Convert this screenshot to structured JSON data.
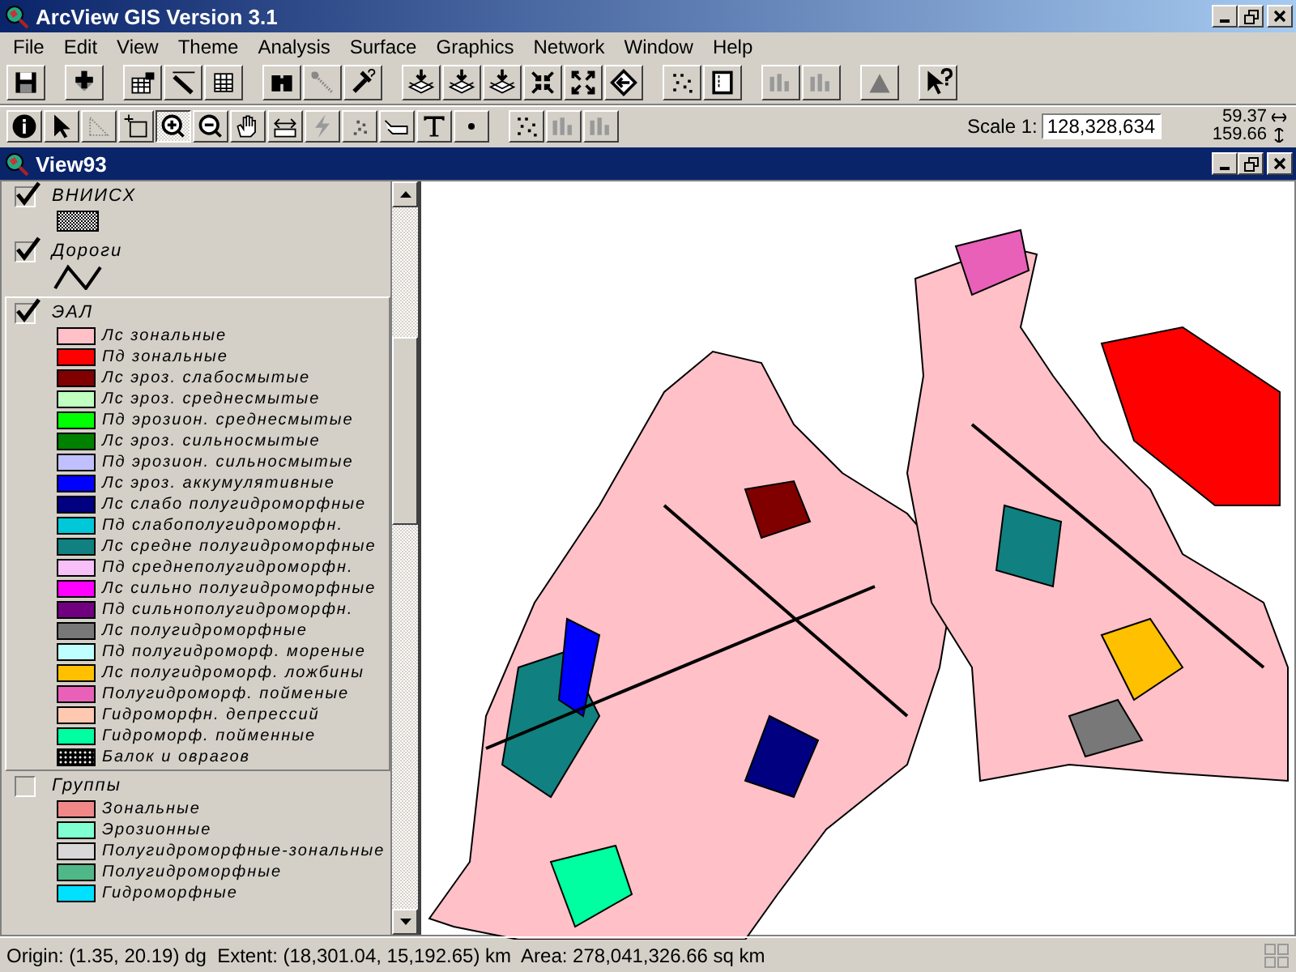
{
  "window": {
    "title": "ArcView GIS Version 3.1"
  },
  "menu": [
    "File",
    "Edit",
    "View",
    "Theme",
    "Analysis",
    "Surface",
    "Graphics",
    "Network",
    "Window",
    "Help"
  ],
  "tool_bar": {
    "tools": [
      {
        "selected": false
      },
      {
        "selected": false
      },
      {
        "selected": false
      },
      {
        "selected": false
      },
      {
        "selected": true
      },
      {
        "selected": false
      },
      {
        "selected": false
      },
      {
        "selected": false
      },
      {
        "selected": false
      },
      {
        "selected": false
      },
      {
        "selected": false
      },
      {
        "selected": false
      },
      {
        "selected": false
      }
    ],
    "scale_label": "Scale 1:",
    "scale_value": "128,328,634",
    "x_reading": "59.37",
    "y_reading": "159.66"
  },
  "view": {
    "title": "View93"
  },
  "legend": {
    "themes": [
      {
        "name": "ВНИИСХ",
        "checked": true,
        "selected": false,
        "kind": "hatch"
      },
      {
        "name": "Дороги",
        "checked": true,
        "selected": false,
        "kind": "line"
      },
      {
        "name": "ЭАЛ",
        "checked": true,
        "selected": true,
        "kind": "classes",
        "classes": [
          {
            "label": "Лс зональные",
            "color": "#ffc0c8",
            "kind": "fill"
          },
          {
            "label": "Пд зональные",
            "color": "#ff0000",
            "kind": "fill"
          },
          {
            "label": "Лс эроз. слабосмытые",
            "color": "#800000",
            "kind": "fill"
          },
          {
            "label": "Лс эроз. среднесмытые",
            "color": "#c0ffc0",
            "kind": "fill"
          },
          {
            "label": "Пд эрозион. среднесмытые",
            "color": "#00ff00",
            "kind": "fill"
          },
          {
            "label": "Лс эроз. сильносмытые",
            "color": "#008000",
            "kind": "fill"
          },
          {
            "label": "Пд эрозион. сильносмытые",
            "color": "#c0c0ff",
            "kind": "fill"
          },
          {
            "label": "Лс эроз. аккумулятивные",
            "color": "#0000ff",
            "kind": "fill"
          },
          {
            "label": "Лс слабо полугидроморфные",
            "color": "#000080",
            "kind": "fill"
          },
          {
            "label": "Пд слабополугидроморфн.",
            "color": "#00c8d8",
            "kind": "fill"
          },
          {
            "label": "Лс средне полугидроморфные",
            "color": "#108080",
            "kind": "fill"
          },
          {
            "label": "Пд среднеполугидроморфн.",
            "color": "#f8c0f8",
            "kind": "fill"
          },
          {
            "label": "Лс сильно полугидроморфные",
            "color": "#ff00ff",
            "kind": "fill"
          },
          {
            "label": "Пд сильнополугидроморфн.",
            "color": "#700080",
            "kind": "fill"
          },
          {
            "label": "Лс полугидроморфные",
            "color": "#787878",
            "kind": "fill"
          },
          {
            "label": "Пд полугидроморф. мореные",
            "color": "#c0ffff",
            "kind": "fill"
          },
          {
            "label": "Лс полугидроморф. ложбины",
            "color": "#ffc000",
            "kind": "fill"
          },
          {
            "label": "Полугидроморф. пойменые",
            "color": "#e860b8",
            "kind": "fill"
          },
          {
            "label": "Гидроморфн. депрессий",
            "color": "#ffc8b0",
            "kind": "fill"
          },
          {
            "label": "Гидроморф. пойменные",
            "color": "#00ffa0",
            "kind": "fill"
          },
          {
            "label": "Балок и оврагов",
            "color": "#000000",
            "kind": "dots"
          }
        ]
      },
      {
        "name": "Группы",
        "checked": false,
        "selected": false,
        "kind": "classes",
        "classes": [
          {
            "label": "Зональные",
            "color": "#f08888",
            "kind": "fill"
          },
          {
            "label": "Эрозионные",
            "color": "#80ffd0",
            "kind": "fill"
          },
          {
            "label": "Полугидроморфные-зональные",
            "color": "#d8d8d8",
            "kind": "fill"
          },
          {
            "label": "Полугидроморфные",
            "color": "#50b888",
            "kind": "fill"
          },
          {
            "label": "Гидроморфные",
            "color": "#00e0ff",
            "kind": "fill"
          }
        ]
      }
    ]
  },
  "status_bar": {
    "text": "Origin: (1.35, 20.19) dg  Extent: (18,301.04, 15,192.65) km  Area: 278,041,326.66 sq km"
  }
}
